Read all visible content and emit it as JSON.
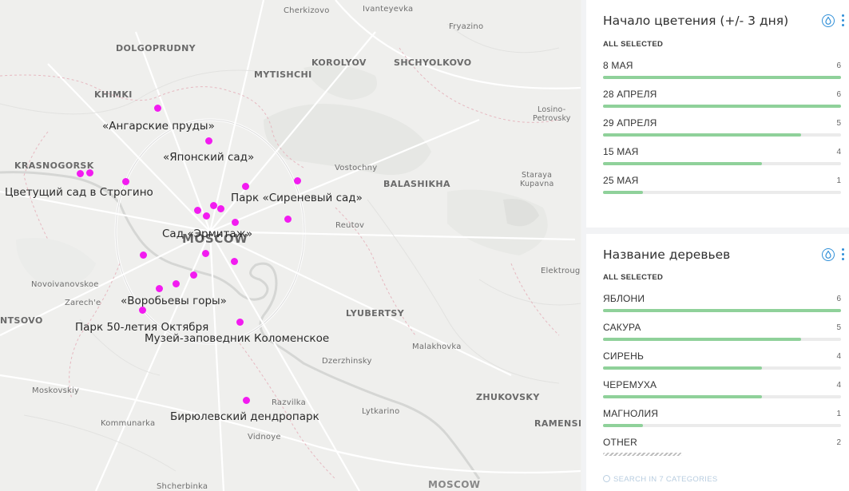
{
  "map": {
    "places": [
      {
        "id": "cherkizovo",
        "text": "Cherkizovo"
      },
      {
        "id": "ivanteyevka",
        "text": "Ivanteyevka"
      },
      {
        "id": "fryazino",
        "text": "Fryazino"
      },
      {
        "id": "dolgoprudny",
        "text": "DOLGOPRUDNY"
      },
      {
        "id": "korolyov",
        "text": "KOROLYOV"
      },
      {
        "id": "shchyolkovo",
        "text": "SHCHYOLKOVO"
      },
      {
        "id": "mytishchi",
        "text": "MYTISHCHI"
      },
      {
        "id": "khimki",
        "text": "KHIMKI"
      },
      {
        "id": "losino",
        "text": "Losino-"
      },
      {
        "id": "petrovsky",
        "text": "Petrovsky"
      },
      {
        "id": "krasnogorsk",
        "text": "KRASNOGORSK"
      },
      {
        "id": "vostochny",
        "text": "Vostochny"
      },
      {
        "id": "balashikha",
        "text": "BALASHIKHA"
      },
      {
        "id": "staraya",
        "text": "Staraya"
      },
      {
        "id": "kupavna",
        "text": "Kupavna"
      },
      {
        "id": "reutov",
        "text": "Reutov"
      },
      {
        "id": "moscow",
        "text": "MOSCOW"
      },
      {
        "id": "elektrougli",
        "text": "Elektroug"
      },
      {
        "id": "novoivanovskoe",
        "text": "Novoivanovskoe"
      },
      {
        "id": "zarechye",
        "text": "Zarech'e"
      },
      {
        "id": "ntsovo",
        "text": "NTSOVO"
      },
      {
        "id": "lyubertsy",
        "text": "LYUBERTSY"
      },
      {
        "id": "malakhovka",
        "text": "Malakhovka"
      },
      {
        "id": "dzerzhinsky",
        "text": "Dzerzhinsky"
      },
      {
        "id": "moskovskiy",
        "text": "Moskovskiy"
      },
      {
        "id": "zhukovsky",
        "text": "ZHUKOVSKY"
      },
      {
        "id": "razvilka",
        "text": "Razvilka"
      },
      {
        "id": "lytkarino",
        "text": "Lytkarino"
      },
      {
        "id": "kommunarka",
        "text": "Kommunarka"
      },
      {
        "id": "ramensk",
        "text": "RAMENSK"
      },
      {
        "id": "vidnoye",
        "text": "Vidnoye"
      },
      {
        "id": "shcherbinka",
        "text": "Shcherbinka"
      },
      {
        "id": "moscow_bottom",
        "text": "MOSCOW"
      }
    ],
    "pois": [
      {
        "id": "angarskie",
        "text": "«Ангарские пруды»"
      },
      {
        "id": "yaponsky",
        "text": "«Японский сад»"
      },
      {
        "id": "strogino",
        "text": "Цветущий сад в Строгино"
      },
      {
        "id": "sirenevy",
        "text": "Парк «Сиреневый сад»"
      },
      {
        "id": "ermitazh",
        "text": "Сад «Эрмитаж»"
      },
      {
        "id": "vorobyovy",
        "text": "«Воробьевы горы»"
      },
      {
        "id": "park50",
        "text": "Парк 50-летия Октября"
      },
      {
        "id": "kolomenskoe",
        "text": "Музей-заповедник Коломенское"
      },
      {
        "id": "biryulevsky",
        "text": "Бирюлевский дендропарк"
      }
    ],
    "marker_color": "#f21bf0"
  },
  "widgets": [
    {
      "title": "Начало цветения (+/- 3 дня)",
      "status": "ALL SELECTED",
      "items": [
        {
          "label": "8 МАЯ",
          "count": "6",
          "fraction": 1.0
        },
        {
          "label": "28 АПРЕЛЯ",
          "count": "6",
          "fraction": 1.0
        },
        {
          "label": "29 АПРЕЛЯ",
          "count": "5",
          "fraction": 0.833
        },
        {
          "label": "15 МАЯ",
          "count": "4",
          "fraction": 0.667
        },
        {
          "label": "25 МАЯ",
          "count": "1",
          "fraction": 0.167
        }
      ]
    },
    {
      "title": "Название деревьев",
      "status": "ALL SELECTED",
      "items": [
        {
          "label": "ЯБЛОНИ",
          "count": "6",
          "fraction": 1.0
        },
        {
          "label": "САКУРА",
          "count": "5",
          "fraction": 0.833
        },
        {
          "label": "СИРЕНЬ",
          "count": "4",
          "fraction": 0.667
        },
        {
          "label": "ЧЕРЕМУХА",
          "count": "4",
          "fraction": 0.667
        },
        {
          "label": "МАГНОЛИЯ",
          "count": "1",
          "fraction": 0.167
        },
        {
          "label": "OTHER",
          "count": "2",
          "fraction": 0.333
        }
      ],
      "search_placeholder": "SEARCH IN 7 CATEGORIES"
    }
  ],
  "colors": {
    "bar": "#8fd19a",
    "accent": "#2f8fd8"
  }
}
